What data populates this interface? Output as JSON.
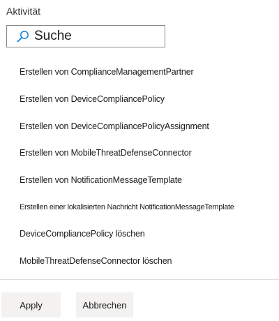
{
  "filter": {
    "title": "Aktivität",
    "search_placeholder": "Suche"
  },
  "activities": [
    "Erstellen von ComplianceManagementPartner",
    "Erstellen von DeviceCompliancePolicy",
    "Erstellen von DeviceCompliancePolicyAssignment",
    "Erstellen von MobileThreatDefenseConnector",
    "Erstellen von NotificationMessageTemplate",
    "Erstellen einer lokalisierten Nachricht NotificationMessageTemplate",
    "DeviceCompliancePolicy löschen",
    "MobileThreatDefenseConnector löschen"
  ],
  "actions": {
    "apply_label": "Apply",
    "cancel_label": "Abbrechen"
  },
  "icons": {
    "search": "search-icon"
  },
  "colors": {
    "border": "#8a8886",
    "button_bg": "#f3f2f1",
    "divider": "#e1dfdd",
    "search_icon": "#0078d4"
  }
}
